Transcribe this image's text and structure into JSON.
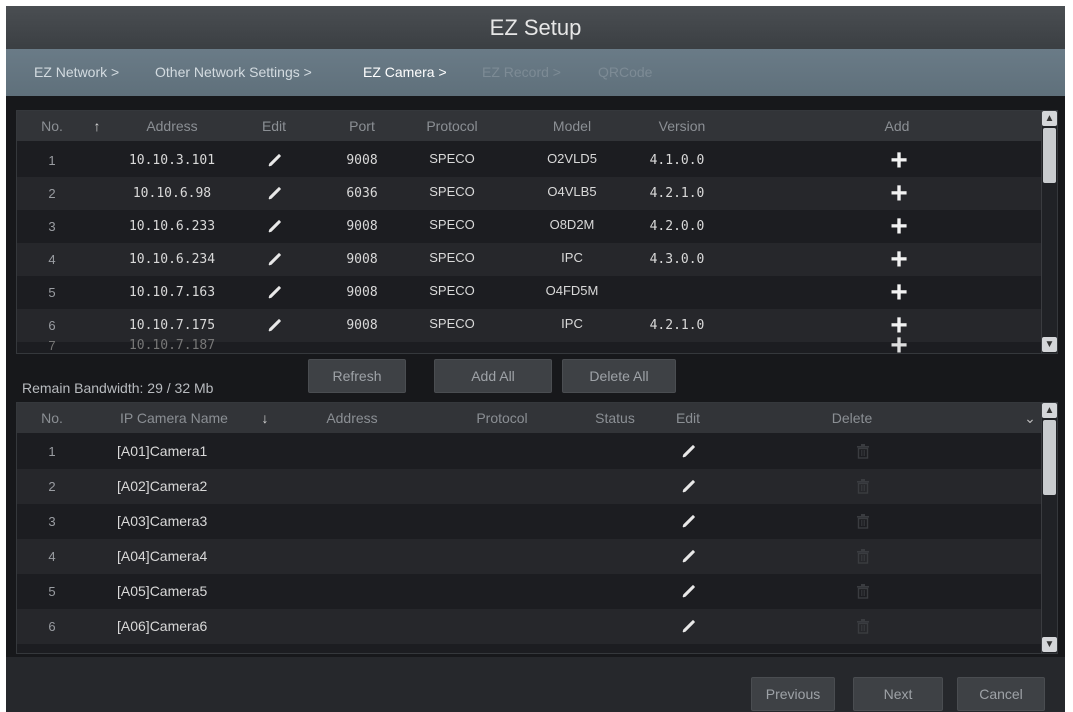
{
  "window": {
    "title": "EZ Setup"
  },
  "breadcrumbs": [
    {
      "label": "EZ Network >",
      "state": "normal"
    },
    {
      "label": "Other Network Settings >",
      "state": "normal"
    },
    {
      "label": "EZ Camera >",
      "state": "active"
    },
    {
      "label": "EZ Record >",
      "state": "disabled"
    },
    {
      "label": "QRCode",
      "state": "disabled"
    }
  ],
  "search_table": {
    "headers": {
      "no": "No.",
      "sort_icon": "arrow-up-icon",
      "address": "Address",
      "edit": "Edit",
      "port": "Port",
      "protocol": "Protocol",
      "model": "Model",
      "version": "Version",
      "add": "Add"
    },
    "rows": [
      {
        "no": "1",
        "address": "10.10.3.101",
        "port": "9008",
        "protocol": "SPECO",
        "model": "O2VLD5",
        "version": "4.1.0.0"
      },
      {
        "no": "2",
        "address": "10.10.6.98",
        "port": "6036",
        "protocol": "SPECO",
        "model": "O4VLB5",
        "version": "4.2.1.0"
      },
      {
        "no": "3",
        "address": "10.10.6.233",
        "port": "9008",
        "protocol": "SPECO",
        "model": "O8D2M",
        "version": "4.2.0.0"
      },
      {
        "no": "4",
        "address": "10.10.6.234",
        "port": "9008",
        "protocol": "SPECO",
        "model": "IPC",
        "version": "4.3.0.0"
      },
      {
        "no": "5",
        "address": "10.10.7.163",
        "port": "9008",
        "protocol": "SPECO",
        "model": "O4FD5M",
        "version": ""
      },
      {
        "no": "6",
        "address": "10.10.7.175",
        "port": "9008",
        "protocol": "SPECO",
        "model": "IPC",
        "version": "4.2.1.0"
      }
    ]
  },
  "bandwidth": {
    "label": "Remain Bandwidth: 29 / 32 Mb"
  },
  "actions": {
    "refresh": "Refresh",
    "add_all": "Add All",
    "delete_all": "Delete All"
  },
  "added_table": {
    "headers": {
      "no": "No.",
      "name": "IP Camera Name",
      "sort_icon": "arrow-down-icon",
      "address": "Address",
      "protocol": "Protocol",
      "status": "Status",
      "edit": "Edit",
      "delete": "Delete"
    },
    "rows": [
      {
        "no": "1",
        "name": "[A01]Camera1"
      },
      {
        "no": "2",
        "name": "[A02]Camera2"
      },
      {
        "no": "3",
        "name": "[A03]Camera3"
      },
      {
        "no": "4",
        "name": "[A04]Camera4"
      },
      {
        "no": "5",
        "name": "[A05]Camera5"
      },
      {
        "no": "6",
        "name": "[A06]Camera6"
      }
    ]
  },
  "footer": {
    "previous": "Previous",
    "next": "Next",
    "cancel": "Cancel"
  },
  "colors": {
    "title_bar": "#3f4347",
    "breadcrumb_bar": "#65757f",
    "background": "#17181b",
    "row_alt": "#26272b"
  }
}
